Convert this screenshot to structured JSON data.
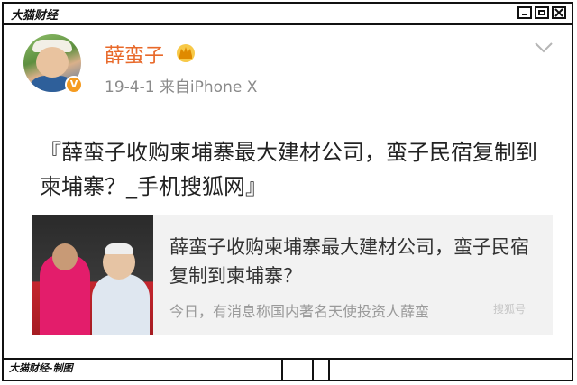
{
  "window": {
    "title": "大猫财经"
  },
  "post": {
    "username": "薛蛮子",
    "verified_badge": "V",
    "meta": "19-4-1  来自iPhone X",
    "text": "『薛蛮子收购柬埔寨最大建材公司，蛮子民宿复制到柬埔寨？_手机搜狐网』"
  },
  "card": {
    "title": "薛蛮子收购柬埔寨最大建材公司，蛮子民宿复制到柬埔寨？",
    "subtitle": "今日，有消息称国内著名天使投资人薛蛮",
    "watermark": "搜狐号"
  },
  "footer": {
    "label": "大猫财经-制图"
  },
  "colors": {
    "username": "#e8692a",
    "badge": "#f59b20"
  }
}
